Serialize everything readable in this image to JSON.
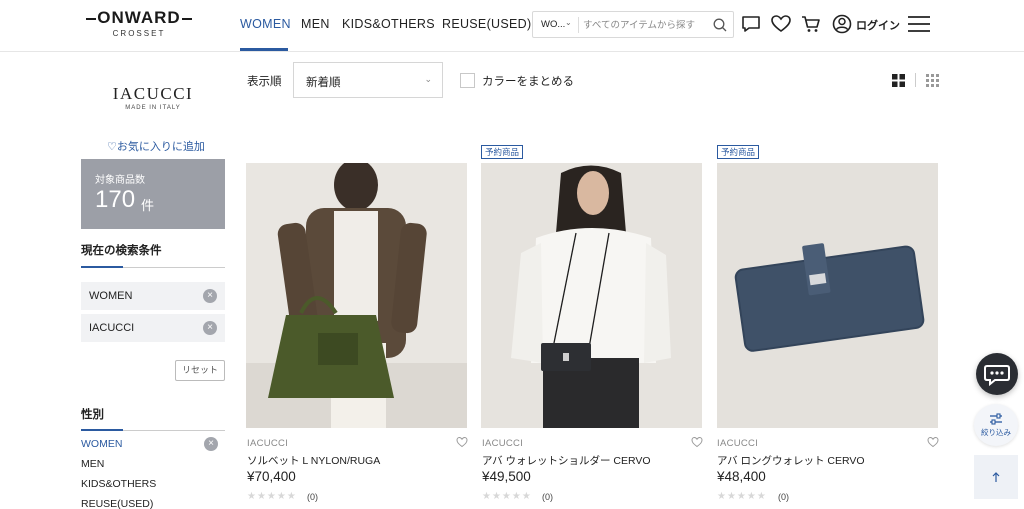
{
  "header": {
    "logo_main": "ONWARD",
    "logo_sub": "CROSSET",
    "nav": [
      "WOMEN",
      "MEN",
      "KIDS&OTHERS",
      "REUSE(USED)"
    ],
    "search_scope": "WO...",
    "search_placeholder": "すべてのアイテムから探す",
    "login_label": "ログイン"
  },
  "sidebar": {
    "brand_name": "IACUCCI",
    "brand_sub": "MADE IN ITALY",
    "favorite_link": "♡お気に入りに追加",
    "count_label": "対象商品数",
    "count_value": "170",
    "count_unit": "件",
    "current_conditions_title": "現在の検索条件",
    "conditions": [
      "WOMEN",
      "IACUCCI"
    ],
    "reset_label": "リセット",
    "gender_title": "性別",
    "genders": [
      "WOMEN",
      "MEN",
      "KIDS&OTHERS",
      "REUSE(USED)"
    ]
  },
  "sort": {
    "label": "表示順",
    "value": "新着順",
    "color_group_label": "カラーをまとめる"
  },
  "products": [
    {
      "tag": "",
      "brand": "IACUCCI",
      "name": "ソルベット L NYLON/RUGA",
      "price": "¥70,400",
      "reviews": "(0)"
    },
    {
      "tag": "予約商品",
      "brand": "IACUCCI",
      "name": "アバ ウォレットショルダー CERVO",
      "price": "¥49,500",
      "reviews": "(0)"
    },
    {
      "tag": "予約商品",
      "brand": "IACUCCI",
      "name": "アバ ロングウォレット CERVO",
      "price": "¥48,400",
      "reviews": "(0)"
    }
  ],
  "floating": {
    "filter_label": "絞り込み"
  },
  "colors": {
    "accent": "#2b5aa0",
    "count_box": "#9c9fa7"
  }
}
